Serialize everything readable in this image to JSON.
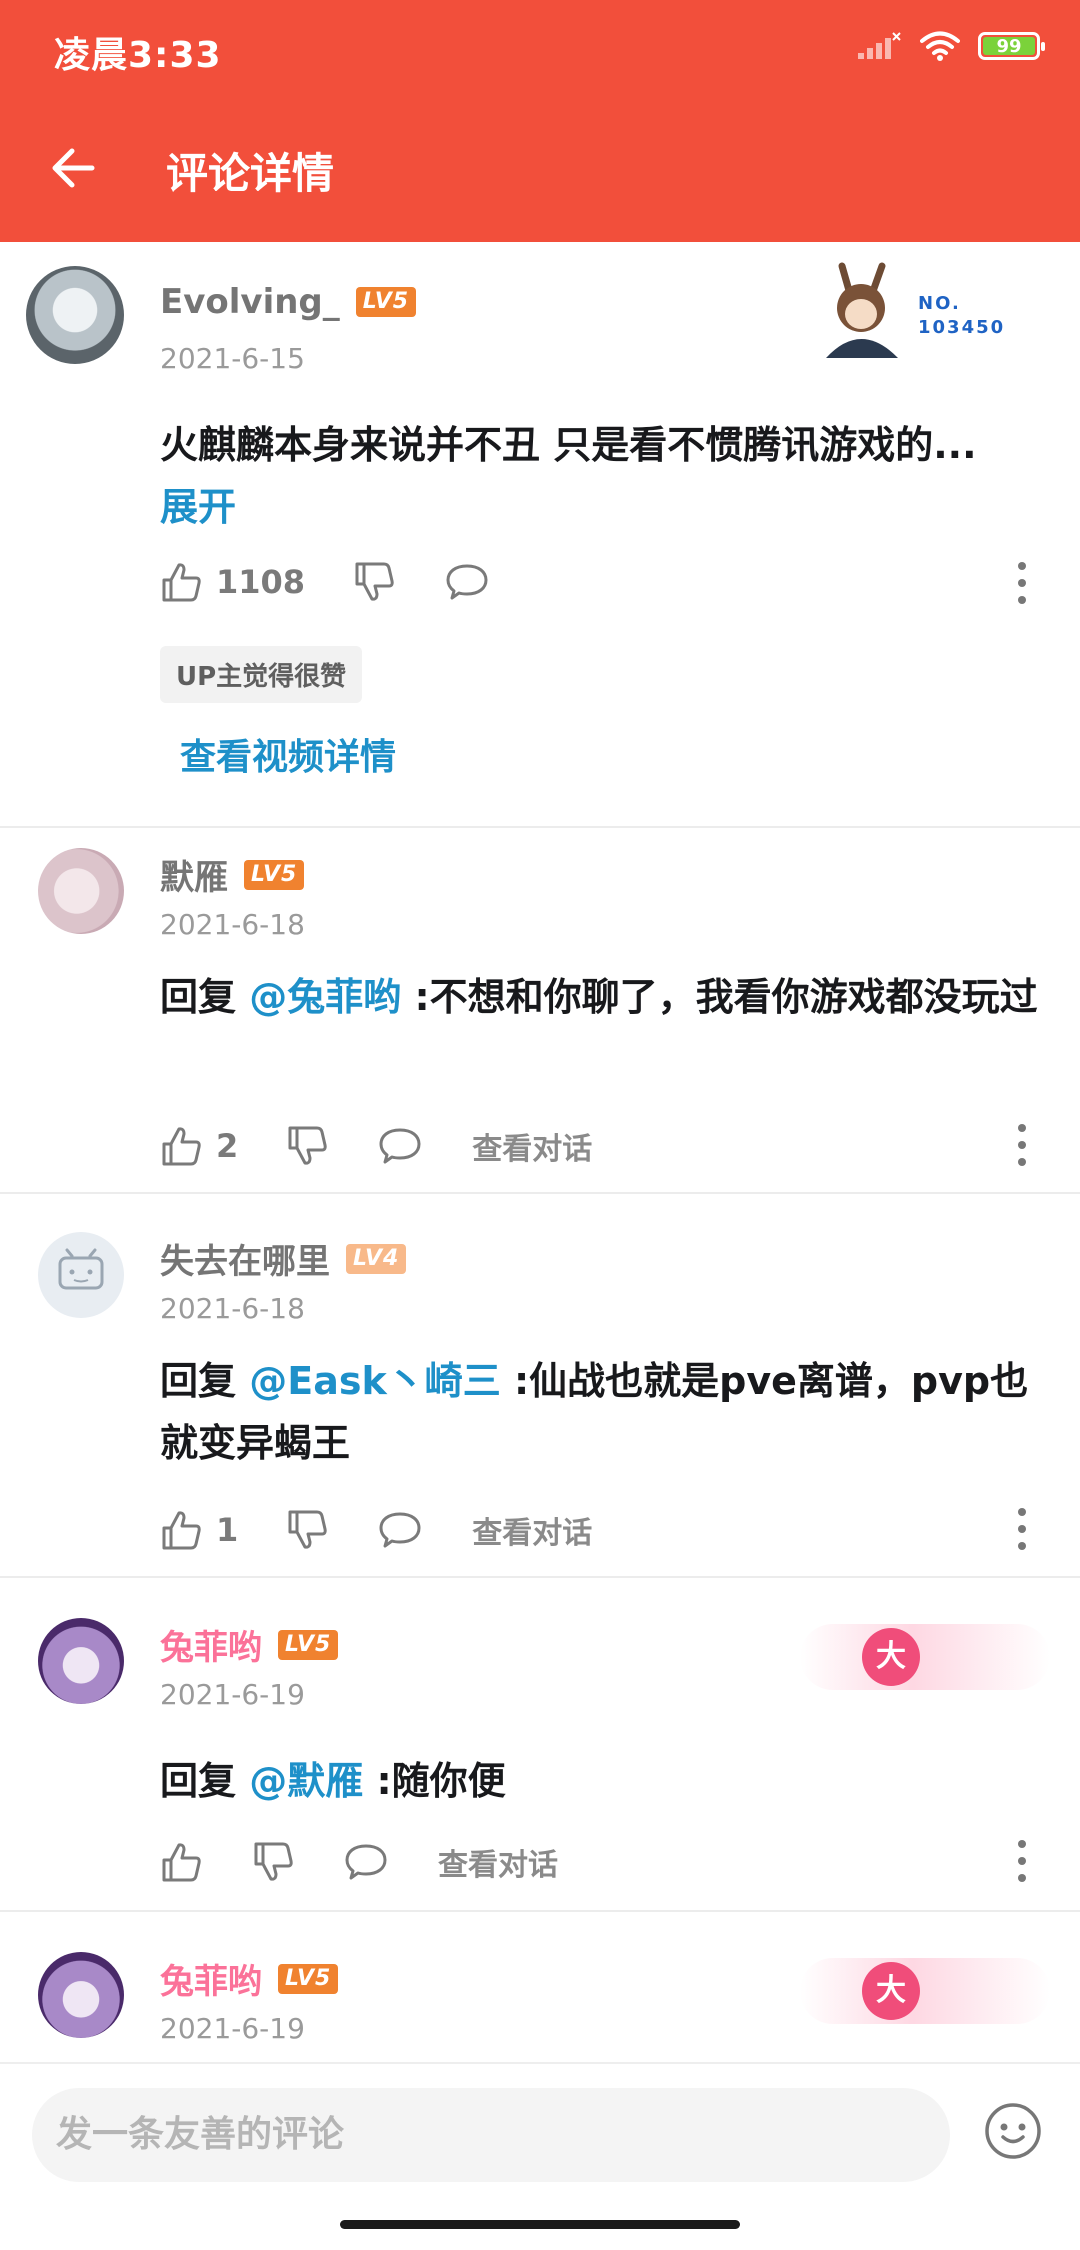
{
  "status_bar": {
    "time": "凌晨3:33",
    "battery": "99"
  },
  "header": {
    "title": "评论详情"
  },
  "main_comment": {
    "username": "Evolving_",
    "level": "LV5",
    "date": "2021-6-15",
    "badge_number": "NO.\n103450",
    "text": "火麒麟本身来说并不丑  只是看不惯腾讯游戏的...",
    "expand_label": "展开",
    "likes": "1108",
    "up_tag": "UP主觉得很赞",
    "video_link": "查看视频详情"
  },
  "replies": [
    {
      "username": "默雁",
      "level": "LV5",
      "date": "2021-6-18",
      "reply_prefix": "回复 ",
      "mention": "@兔菲哟",
      "text": " :不想和你聊了，我看你游戏都没玩过",
      "likes": "2",
      "view_conversation": "查看对话"
    },
    {
      "username": "失去在哪里",
      "level": "LV4",
      "date": "2021-6-18",
      "reply_prefix": "回复 ",
      "mention": "@Eask丶崎三",
      "text": " :仙战也就是pve离谱，pvp也就变异蝎王",
      "likes": "1",
      "view_conversation": "查看对话"
    },
    {
      "username": "兔菲哟",
      "level": "LV5",
      "date": "2021-6-19",
      "reply_prefix": "回复 ",
      "mention": "@默雁",
      "text": " :随你便",
      "likes": "",
      "view_conversation": "查看对话",
      "ornament": "大"
    },
    {
      "username": "兔菲哟",
      "level": "LV5",
      "date": "2021-6-19",
      "ornament": "大"
    }
  ],
  "bottom_bar": {
    "placeholder": "发一条友善的评论"
  },
  "colors": {
    "header": "#f24f3b",
    "link": "#1e90c9",
    "pink_name": "#fb7299",
    "level_badge": "#f0822f"
  },
  "icons": [
    "back-arrow-icon",
    "signal-icon",
    "wifi-icon",
    "battery-icon",
    "thumb-up-icon",
    "thumb-down-icon",
    "comment-icon",
    "more-icon",
    "emoji-icon"
  ]
}
